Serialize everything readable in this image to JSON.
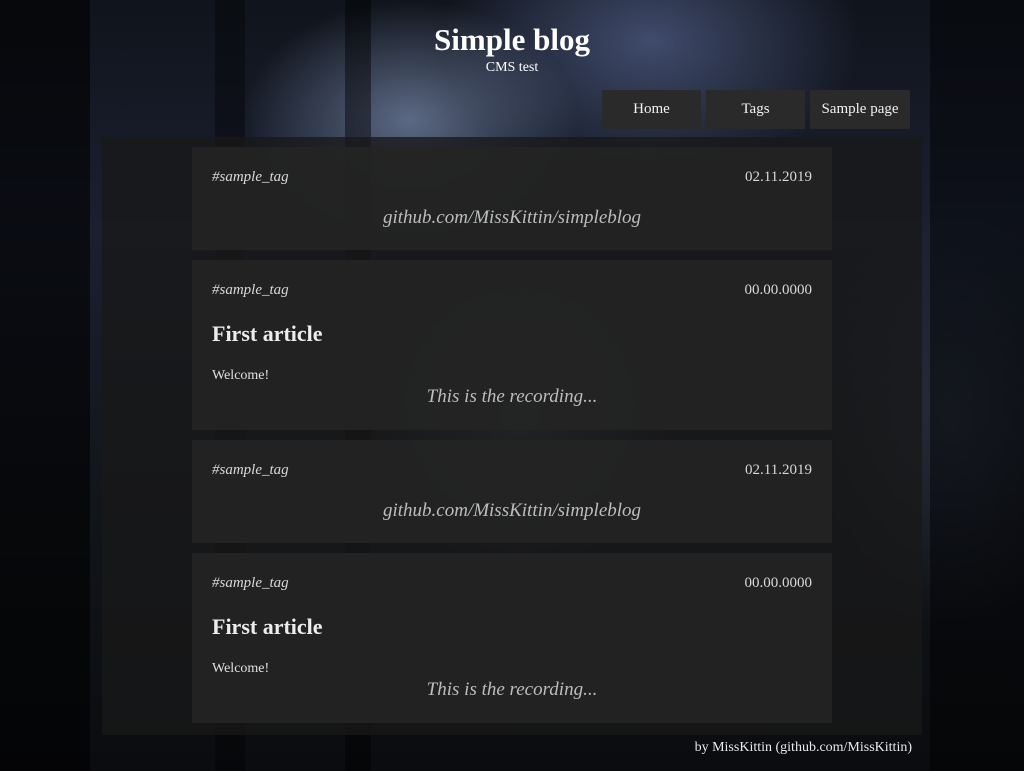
{
  "header": {
    "title": "Simple blog",
    "subtitle": "CMS test"
  },
  "nav": {
    "items": [
      {
        "label": "Home"
      },
      {
        "label": "Tags"
      },
      {
        "label": "Sample page"
      }
    ]
  },
  "posts": [
    {
      "tag": "#sample_tag",
      "date": "02.11.2019",
      "link": "github.com/MissKittin/simpleblog"
    },
    {
      "tag": "#sample_tag",
      "date": "00.00.0000",
      "title": "First article",
      "body": "Welcome!",
      "note": "This is the recording..."
    },
    {
      "tag": "#sample_tag",
      "date": "02.11.2019",
      "link": "github.com/MissKittin/simpleblog"
    },
    {
      "tag": "#sample_tag",
      "date": "00.00.0000",
      "title": "First article",
      "body": "Welcome!",
      "note": "This is the recording..."
    }
  ],
  "footer": {
    "credit": "by MissKittin (github.com/MissKittin)"
  }
}
